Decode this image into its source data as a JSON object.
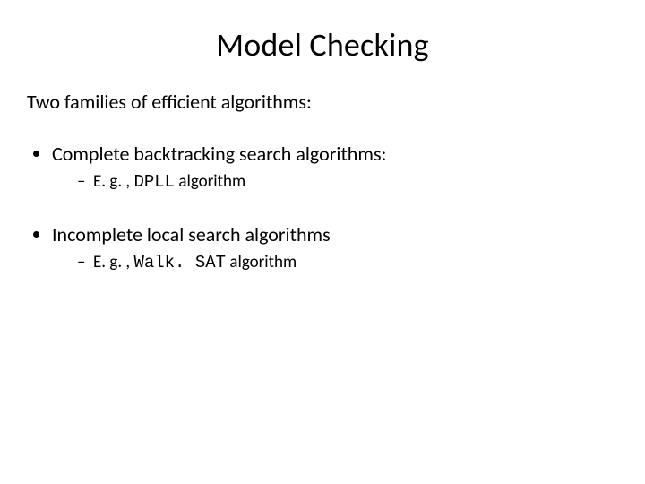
{
  "title": "Model Checking",
  "intro": "Two families of efficient algorithms:",
  "bullets": [
    {
      "text": "Complete backtracking search algorithms:",
      "sub": {
        "prefix": "E. g. , ",
        "code": "DPLL",
        "suffix": " algorithm"
      }
    },
    {
      "text": "Incomplete local search algorithms",
      "sub": {
        "prefix": "E. g. , ",
        "code": "Walk. SAT",
        "suffix": " algorithm"
      }
    }
  ]
}
